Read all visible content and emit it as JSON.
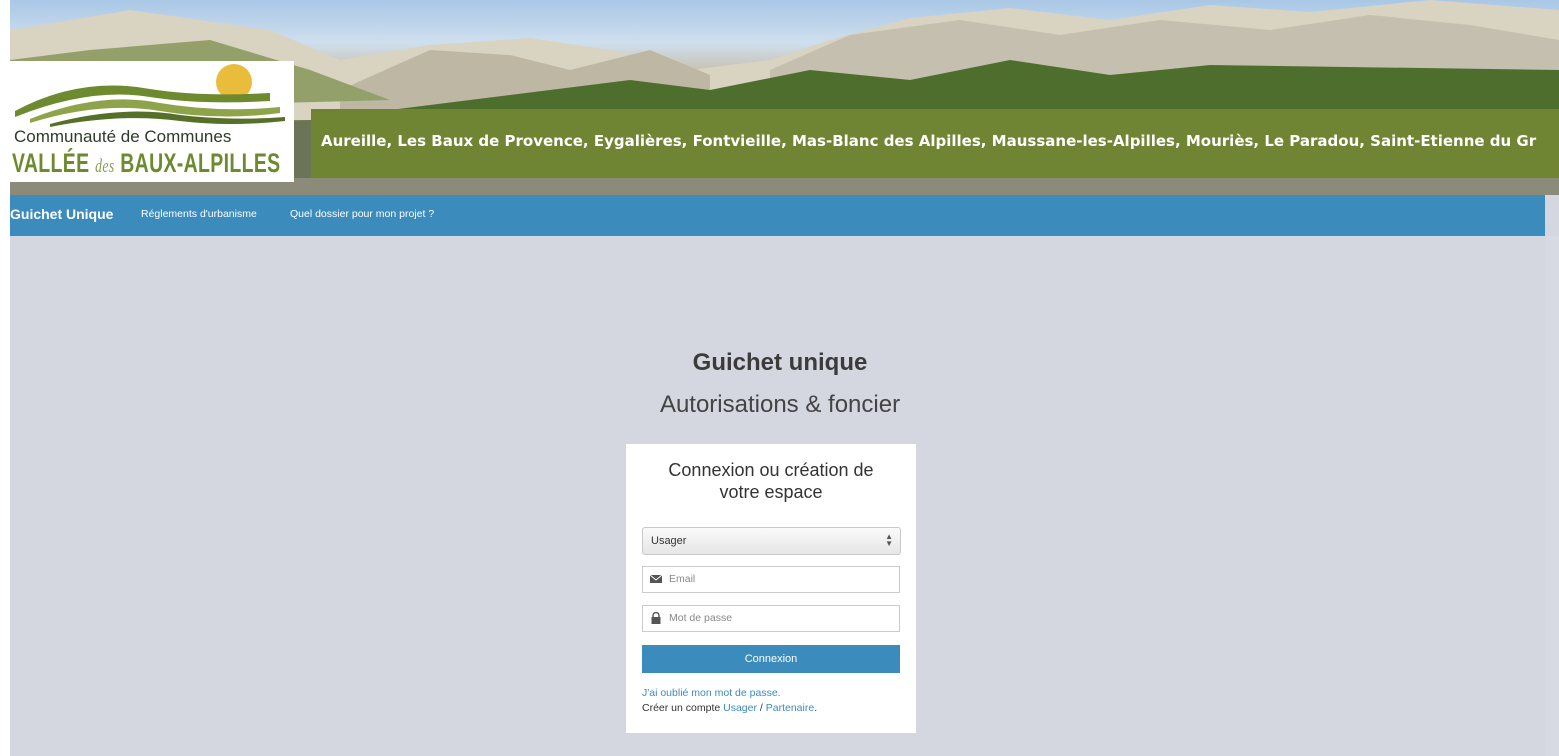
{
  "banner": {
    "logo_line1": "Communauté de Communes",
    "logo_line2_a": "VALLÉE",
    "logo_line2_b": "des",
    "logo_line2_c": "BAUX-ALPILLES",
    "towns": "Aureille, Les Baux de Provence, Eygalières, Fontvieille, Mas-Blanc des Alpilles, Maussane-les-Alpilles, Mouriès, Le Paradou, Saint-Etienne du Gr"
  },
  "nav": {
    "brand": "Guichet Unique",
    "links": [
      "Réglements d'urbanisme",
      "Quel dossier pour mon projet ?"
    ]
  },
  "page": {
    "title": "Guichet unique",
    "subtitle": "Autorisations & foncier"
  },
  "login": {
    "title": "Connexion ou création de votre espace",
    "role_selected": "Usager",
    "email_placeholder": "Email",
    "password_placeholder": "Mot de passe",
    "submit_label": "Connexion",
    "forgot_link": "J'ai oublié mon mot de passe.",
    "create_prefix": "Créer un compte ",
    "create_usager": "Usager",
    "create_sep": " / ",
    "create_partner": "Partenaire",
    "create_suffix": "."
  },
  "colors": {
    "nav_bg": "#3b8bbd",
    "towns_band": "#6f8533",
    "page_bg": "#d4d6e0"
  }
}
